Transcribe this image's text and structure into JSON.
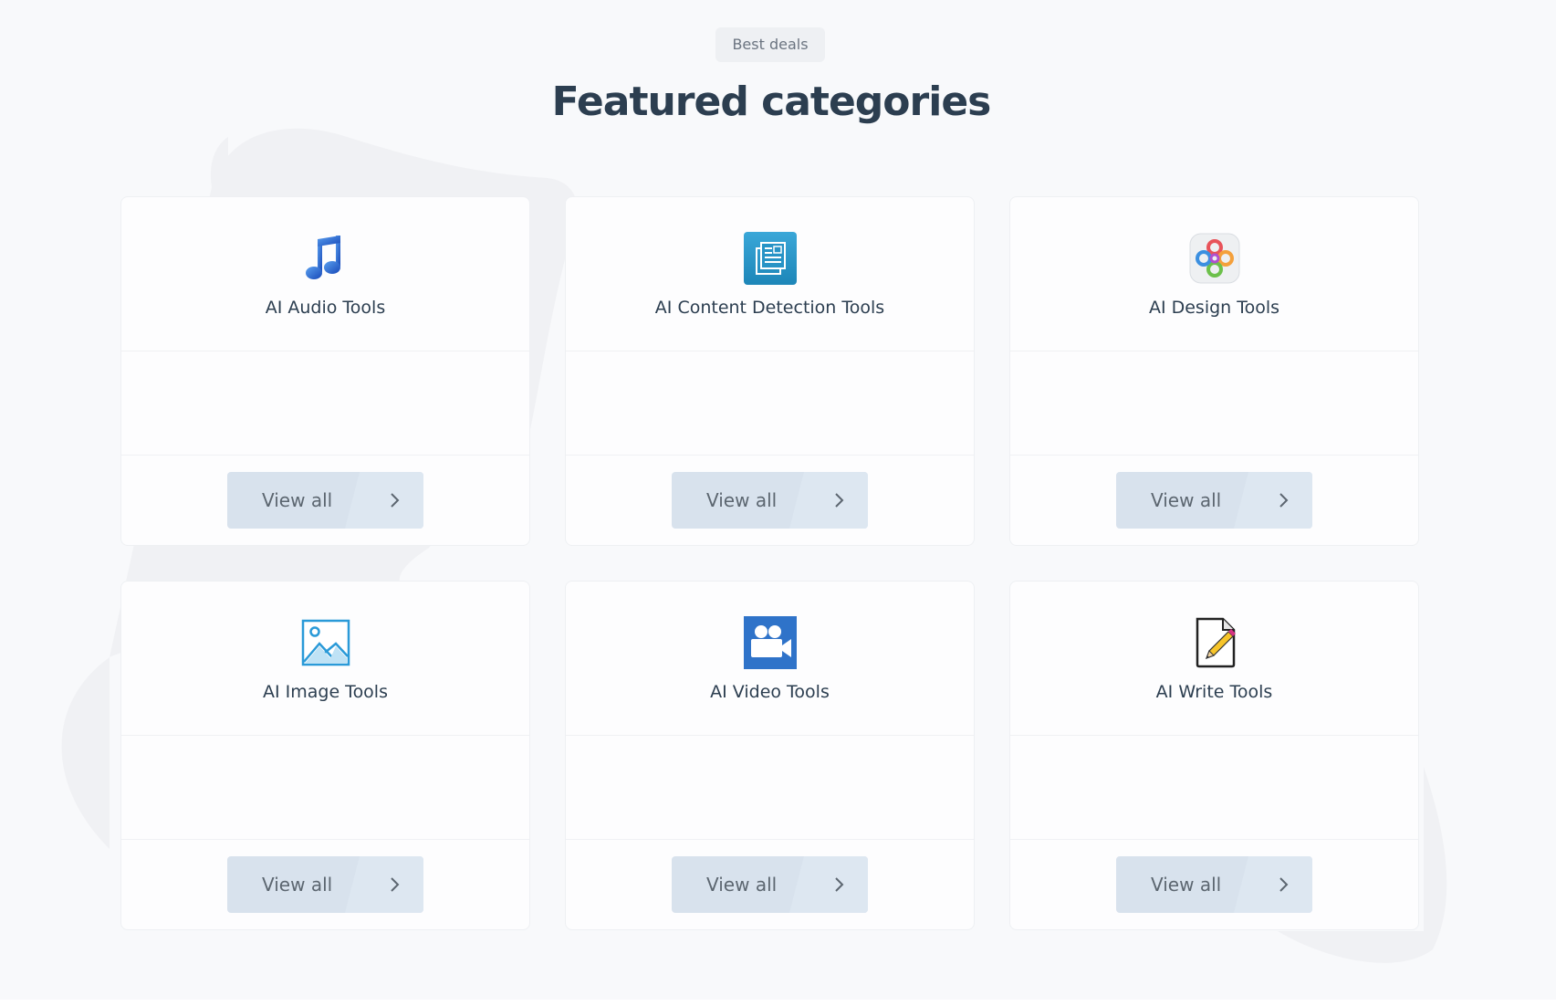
{
  "header": {
    "badge": "Best deals",
    "title": "Featured categories"
  },
  "categories": [
    {
      "label": "AI Audio Tools",
      "icon": "music-note-icon",
      "button": "View all"
    },
    {
      "label": "AI Content Detection Tools",
      "icon": "document-pages-icon",
      "button": "View all"
    },
    {
      "label": "AI Design Tools",
      "icon": "design-knot-icon",
      "button": "View all"
    },
    {
      "label": "AI Image Tools",
      "icon": "image-picture-icon",
      "button": "View all"
    },
    {
      "label": "AI Video Tools",
      "icon": "video-camera-icon",
      "button": "View all"
    },
    {
      "label": "AI Write Tools",
      "icon": "write-pencil-icon",
      "button": "View all"
    }
  ],
  "colors": {
    "background": "#f8f9fb",
    "title": "#2c3e50",
    "button": "#d8e2ed",
    "button_text": "#5c6670"
  }
}
